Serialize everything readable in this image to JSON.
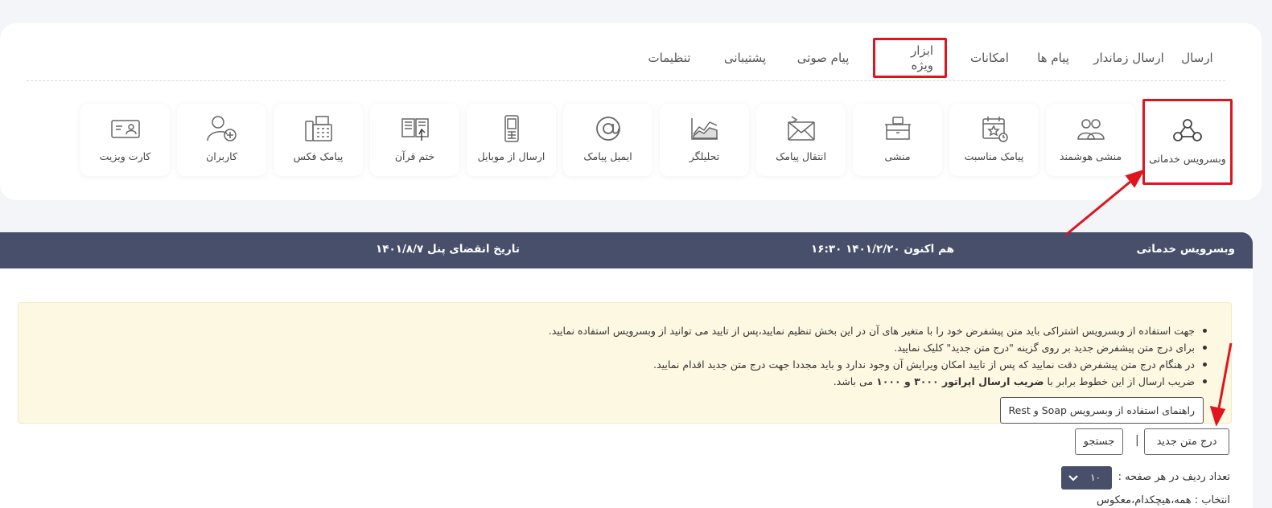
{
  "nav": {
    "items": [
      {
        "label": "ارسال"
      },
      {
        "label": "ارسال زماندار"
      },
      {
        "label": "پیام ها"
      },
      {
        "label": "امکانات"
      },
      {
        "label": "ابزار ویژه",
        "highlighted": true
      },
      {
        "label": "پیام صوتی"
      },
      {
        "label": "پشتیبانی"
      },
      {
        "label": "تنظیمات"
      }
    ]
  },
  "tiles": [
    {
      "label": "وبسرویس خدماتی",
      "icon": "webservice-icon",
      "highlighted": true
    },
    {
      "label": "منشی هوشمند",
      "icon": "people-group-icon"
    },
    {
      "label": "پیامک مناسبت",
      "icon": "calendar-star-icon"
    },
    {
      "label": "منشی",
      "icon": "desk-icon"
    },
    {
      "label": "انتقال پیامک",
      "icon": "envelope-forward-icon"
    },
    {
      "label": "تحلیلگر",
      "icon": "chart-icon"
    },
    {
      "label": "ایمیل پیامک",
      "icon": "at-sign-icon"
    },
    {
      "label": "ارسال از موبایل",
      "icon": "mobile-phone-icon"
    },
    {
      "label": "ختم قرآن",
      "icon": "quran-book-icon"
    },
    {
      "label": "پیامک فکس",
      "icon": "fax-icon"
    },
    {
      "label": "کاربران",
      "icon": "add-user-icon"
    },
    {
      "label": "کارت ویزیت",
      "icon": "business-card-icon"
    }
  ],
  "header": {
    "title": "وبسرویس خدماتی",
    "now_label": "هم اکنون",
    "now_value": "۱۴۰۱/۲/۲۰ ۱۶:۳۰",
    "expiry_label": "تاریخ انقضای پنل",
    "expiry_value": "۱۴۰۱/۸/۷"
  },
  "notice": {
    "line1": "جهت استفاده از وبسرویس اشتراکی باید متن پیشفرض خود را با متغیر های آن در این بخش تنظیم نمایید،پس از تایید می توانید از وبسرویس استفاده نمایید.",
    "line2": "برای درج متن پیشفرض جدید بر روی گزینه \"درج متن جدید\" کلیک نمایید.",
    "line3": "در هنگام درج متن پیشفرض دقت نمایید که پس از تایید امکان ویرایش آن وجود ندارد و باید مجددا جهت درج متن جدید اقدام نمایید.",
    "line4_pre": "ضریب ارسال از این خطوط برابر با",
    "line4_bold": "ضریب ارسال اپراتور ۳۰۰۰ و ۱۰۰۰",
    "line4_post": "می باشد.",
    "guide_button": "راهنمای استفاده از وبسرویس Soap و Rest"
  },
  "actions": {
    "new_text_button": "درج متن جدید",
    "separator": "|",
    "search_button": "جستجو"
  },
  "paging": {
    "rows_label": "تعداد ردیف در هر صفحه :",
    "rows_value": "۱۰"
  },
  "selection": {
    "text": "انتخاب : همه،هیچکدام،معکوس"
  },
  "colors": {
    "header_bar": "#474f6b",
    "highlight": "#e0141e",
    "notice_bg": "#fdf8e2"
  }
}
